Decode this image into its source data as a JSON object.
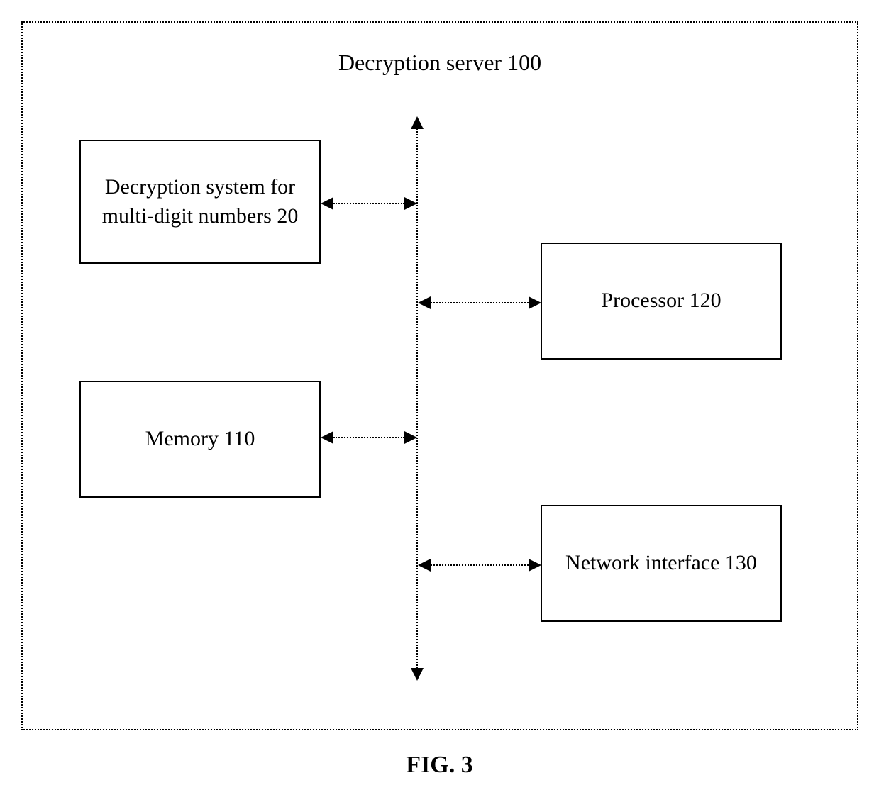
{
  "diagram": {
    "title": "Decryption server 100",
    "boxes": {
      "decryption_system": "Decryption system for multi-digit numbers 20",
      "memory": "Memory 110",
      "processor": "Processor 120",
      "network_interface": "Network interface 130"
    },
    "figure_label": "FIG. 3"
  }
}
